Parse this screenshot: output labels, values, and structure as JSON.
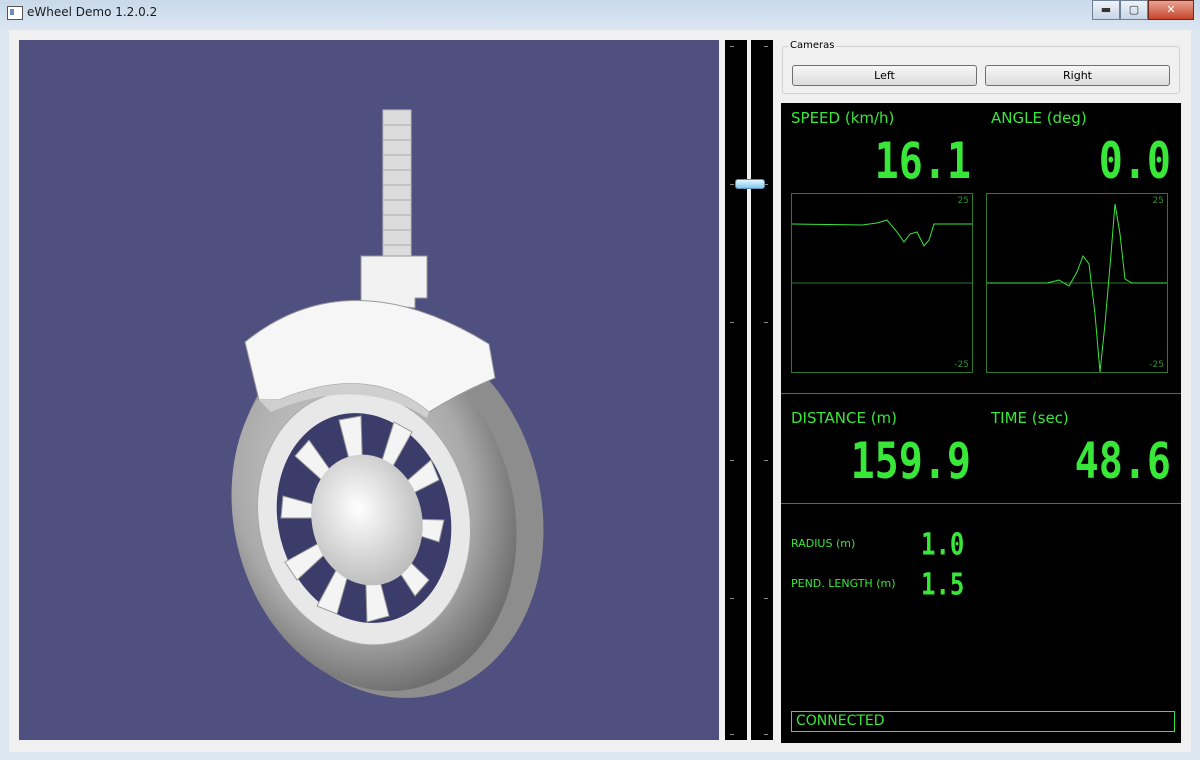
{
  "window": {
    "title": "eWheel Demo 1.2.0.2",
    "minimize": "▬",
    "maximize": "▢",
    "close": "✕"
  },
  "cameras": {
    "legend": "Cameras",
    "left_label": "Left",
    "right_label": "Right"
  },
  "readouts": {
    "speed": {
      "label": "SPEED (km/h)",
      "value": "16.1"
    },
    "angle": {
      "label": "ANGLE (deg)",
      "value": "0.0"
    },
    "distance": {
      "label": "DISTANCE (m)",
      "value": "159.9"
    },
    "time": {
      "label": "TIME (sec)",
      "value": "48.6"
    },
    "radius": {
      "label": "RADIUS (m)",
      "value": "1.0"
    },
    "pend_length": {
      "label": "PEND. LENGTH (m)",
      "value": "1.5"
    }
  },
  "graphs": {
    "speed": {
      "max": "25",
      "min": "-25"
    },
    "angle": {
      "max": "25",
      "min": "-25"
    }
  },
  "slider": {
    "position": 0.2
  },
  "status": "CONNECTED",
  "colors": {
    "display_green": "#39e739",
    "viewport_bg": "#4f4f80"
  }
}
